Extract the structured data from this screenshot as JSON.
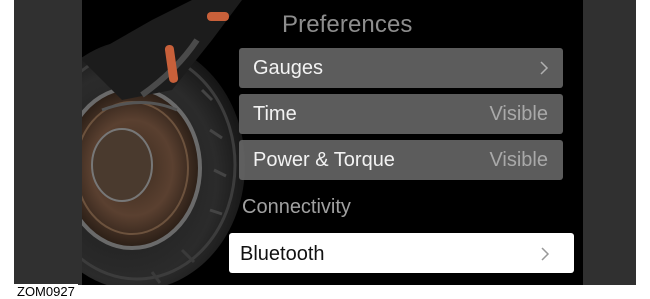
{
  "screen": {
    "title": "Preferences",
    "menu": [
      {
        "label": "Gauges",
        "value": "",
        "chevron": true
      },
      {
        "label": "Time",
        "value": "Visible",
        "chevron": false
      },
      {
        "label": "Power & Torque",
        "value": "Visible",
        "chevron": false
      }
    ],
    "section": "Connectivity",
    "selected_item": {
      "label": "Bluetooth",
      "chevron": true
    }
  },
  "figure_code": "ZOM0927",
  "colors": {
    "screen_bg": "#000000",
    "row_bg": "#696969",
    "selected_bg": "#ffffff",
    "bezel": "#303030"
  }
}
